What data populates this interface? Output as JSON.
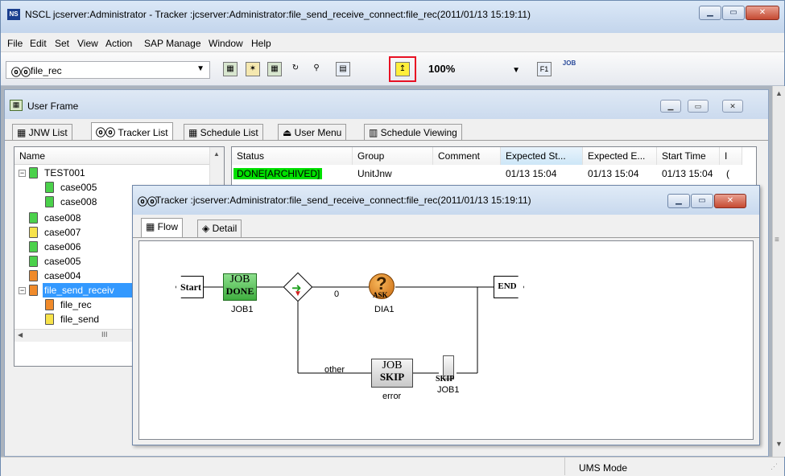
{
  "app": {
    "title": "NSCL jcserver:Administrator - Tracker :jcserver:Administrator:file_send_receive_connect:file_rec(2011/01/13 15:19:11)",
    "icon_text": "NS",
    "controls": [
      "minimize-icon",
      "maximize-icon",
      "close-icon"
    ]
  },
  "menu": [
    "File",
    "Edit",
    "Set",
    "View",
    "Action",
    "SAP Manage",
    "Window",
    "Help"
  ],
  "toolbar": {
    "selector_icon": "tracker-icon",
    "selector_value": "file_rec",
    "zoom_value": "100%",
    "highlight_color": "#e81123",
    "icons": [
      "jnw-icon",
      "schedule-icon",
      "tracker-icon",
      "refresh-icon",
      "find-icon",
      "zoom-icon",
      "up-icon",
      "f1-icon",
      "job-icon"
    ],
    "f1_label": "F1",
    "job_label": "JOB"
  },
  "user_frame": {
    "title": "User Frame",
    "tabs": [
      "JNW List",
      "Tracker List",
      "Schedule List",
      "User Menu",
      "Schedule Viewing"
    ],
    "tree_header": "Name",
    "tree_items": [
      "TEST001",
      "case005",
      "case008",
      "case008",
      "case007",
      "case006",
      "case005",
      "case004",
      "file_send_receiv",
      "file_rec",
      "file_send"
    ],
    "scroll_marker": "III",
    "grid_headers": [
      "Status",
      "Group",
      "Comment",
      "Expected St...",
      "Expected E...",
      "Start Time",
      "I"
    ],
    "grid_row": {
      "status": "DONE[ARCHIVED]",
      "group": "UnitJnw",
      "comment": "",
      "expected_start": "01/13 15:04",
      "expected_end": "01/13 15:04",
      "start_time": "01/13 15:04",
      "extra": "("
    },
    "status_color": "#00e000"
  },
  "tracker": {
    "title": "Tracker :jcserver:Administrator:file_send_receive_connect:file_rec(2011/01/13 15:19:11)",
    "tabs": [
      "Flow",
      "Detail"
    ],
    "flow": {
      "start": "Start",
      "end": "END",
      "job1_line1": "JOB",
      "job1_line2": "DONE",
      "job1_label": "JOB1",
      "branch_label_0": "0",
      "branch_label_other": "other",
      "dia_label": "DIA1",
      "dia_overlay": "ASK",
      "error_line1": "JOB",
      "error_line2": "SKIP",
      "error_label": "error",
      "skip_label": "SKIP",
      "skip_job_label": "JOB1"
    }
  },
  "status": {
    "mode": "UMS Mode"
  }
}
